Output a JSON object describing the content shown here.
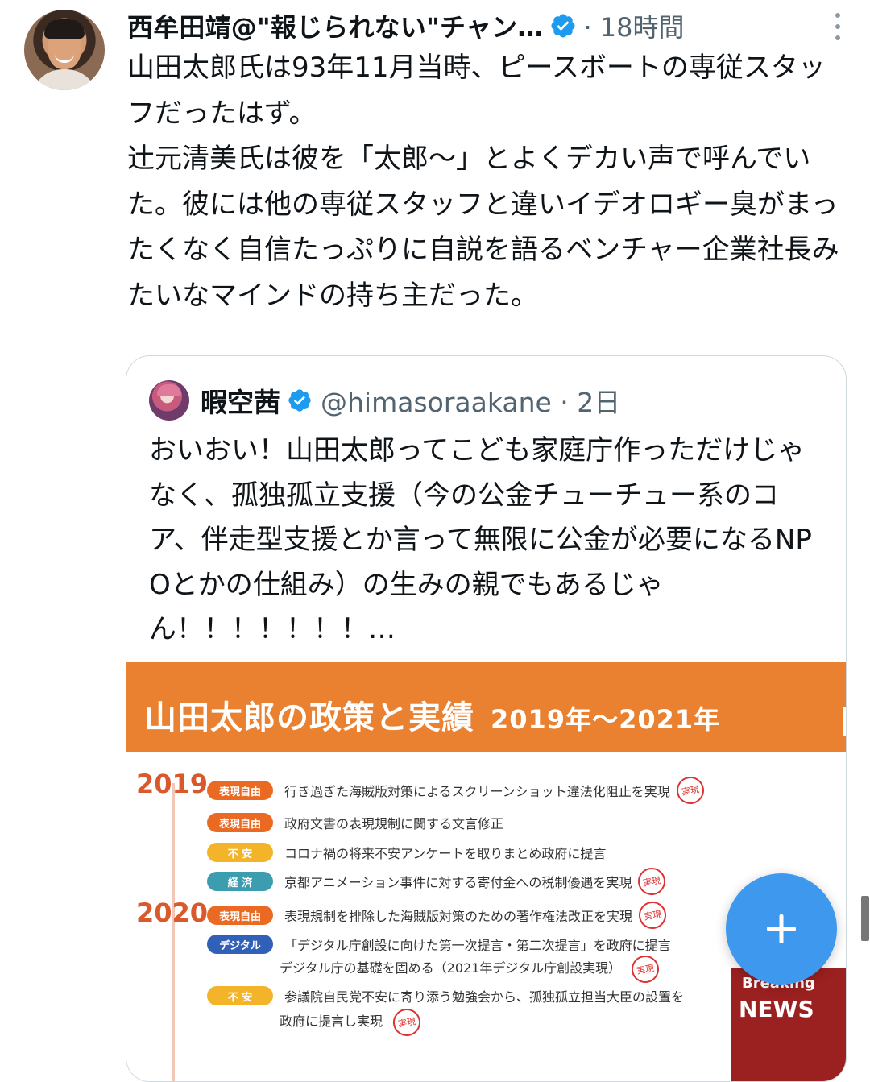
{
  "tweet": {
    "author_name": "西牟田靖@\"報じられない\"チャン…",
    "time": "· 18時間",
    "text": "山田太郎氏は93年11月当時、ピースボートの専従スタッフだったはず。\n辻元清美氏は彼を「太郎〜」とよくデカい声で呼んでいた。彼には他の専従スタッフと違いイデオロギー臭がまったくなく自信たっぷりに自説を語るベンチャー企業社長みたいなマインドの持ち主だった。"
  },
  "quote": {
    "author_name": "暇空茜",
    "handle_time": "@himasoraakane · 2日",
    "text": "おいおい！山田太郎ってこども家庭庁作っただけじゃなく、孤独孤立支援（今の公金チューチュー系のコア、伴走型支援とか言って無限に公金が必要になるNPOとかの仕組み）の生みの親でもあるじゃん！！！！！！！…",
    "image": {
      "title": "山田太郎の政策と実績",
      "title_years": "2019年〜2021年",
      "years": [
        "2019",
        "2020"
      ],
      "rows": [
        {
          "tag": "表現自由",
          "text": "行き過ぎた海賊版対策によるスクリーンショット違法化阻止を実現",
          "stamp": "実現"
        },
        {
          "tag": "表現自由",
          "text": "政府文書の表現規制に関する文言修正",
          "stamp": ""
        },
        {
          "tag": "不 安",
          "text": "コロナ禍の将来不安アンケートを取りまとめ政府に提言",
          "stamp": ""
        },
        {
          "tag": "経 済",
          "text": "京都アニメーション事件に対する寄付金への税制優遇を実現",
          "stamp": "実現"
        },
        {
          "tag": "表現自由",
          "text": "表現規制を排除した海賊版対策のための著作権法改正を実現",
          "stamp": "実現"
        },
        {
          "tag": "デジタル",
          "text": "「デジタル庁創設に向けた第一次提言・第二次提言」を政府に提言",
          "stamp": ""
        },
        {
          "tag": "不 安",
          "text": "参議院自民党不安に寄り添う勉強会から、孤独孤立担当大臣の設置を",
          "stamp": ""
        }
      ],
      "row6_line2": "デジタル庁の基礎を固める（2021年デジタル庁創設実現）",
      "row7_line2": "政府に提言し実現",
      "row6_stamp2": "実現",
      "row7_stamp2": "実現",
      "news_small": "Breaking",
      "news_big": "NEWS"
    }
  },
  "colors": {
    "verified": "#1d9bf0",
    "fab": "#3d98ee",
    "banner": "#ea8130"
  },
  "icons": {
    "fab": "plus-icon",
    "more": "more-vertical-icon",
    "verified": "verified-badge-icon"
  }
}
